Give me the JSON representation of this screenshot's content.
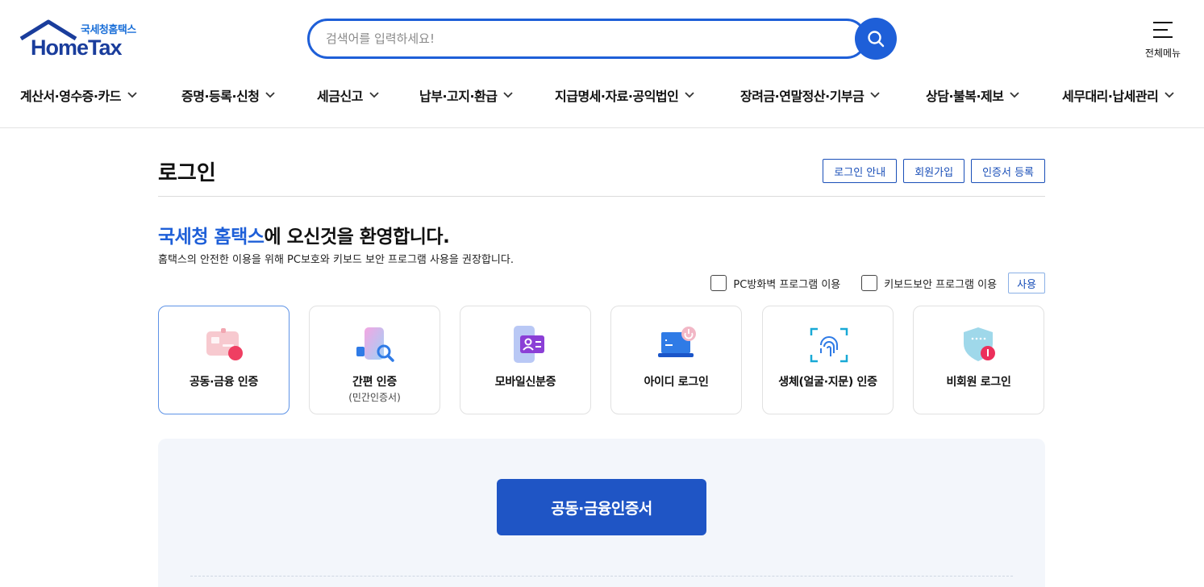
{
  "header": {
    "logo_kr": "국세청홈택스",
    "logo_en": "HomeTax",
    "search_placeholder": "검색어를 입력하세요!",
    "all_menu_label": "전체메뉴"
  },
  "gnb": [
    {
      "label": "계산서·영수증·카드"
    },
    {
      "label": "증명·등록·신청"
    },
    {
      "label": "세금신고"
    },
    {
      "label": "납부·고지·환급"
    },
    {
      "label": "지급명세·자료·공익법인"
    },
    {
      "label": "장려금·연말정산·기부금"
    },
    {
      "label": "상담·불복·제보"
    },
    {
      "label": "세무대리·납세관리"
    }
  ],
  "login": {
    "title": "로그인",
    "top_buttons": [
      "로그인 안내",
      "회원가입",
      "인증서 등록"
    ],
    "welcome_brand": "국세청 홈택스",
    "welcome_rest": "에 오신것을 환영합니다.",
    "subtitle": "홈택스의 안전한 이용을 위해 PC보호와 키보드 보안 프로그램 사용을 권장합니다.",
    "option_firewall": "PC방화벽 프로그램 이용",
    "option_keyboard": "키보드보안 프로그램 이용",
    "use_button": "사용",
    "methods": [
      {
        "label": "공동·금융 인증",
        "sub": "",
        "icon": "certificate-card-icon",
        "active": true
      },
      {
        "label": "간편 인증",
        "sub": "(민간인증서)",
        "icon": "simple-auth-search-icon",
        "active": false
      },
      {
        "label": "모바일신분증",
        "sub": "",
        "icon": "mobile-id-icon",
        "active": false
      },
      {
        "label": "아이디 로그인",
        "sub": "",
        "icon": "laptop-power-icon",
        "active": false
      },
      {
        "label": "생체(얼굴·지문) 인증",
        "sub": "",
        "icon": "fingerprint-icon",
        "active": false
      },
      {
        "label": "비회원 로그인",
        "sub": "",
        "icon": "shield-key-icon",
        "active": false
      }
    ],
    "main_button": "공동·금융인증서"
  },
  "colors": {
    "brand_blue": "#1e5fd8",
    "button_blue": "#1f55c5",
    "panel_bg": "#f3f6fb"
  }
}
